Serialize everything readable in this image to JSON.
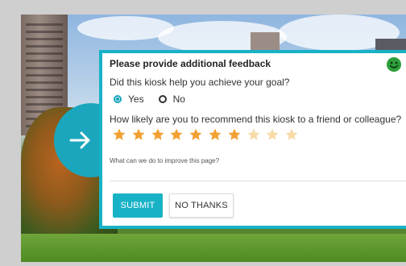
{
  "feedback": {
    "title": "Please provide additional feedback",
    "question_goal": "Did this kiosk help you achieve your goal?",
    "options": [
      {
        "label": "Yes",
        "selected": true
      },
      {
        "label": "No",
        "selected": false
      }
    ],
    "question_recommend": "How likely are you to recommend this kiosk to a friend or colleague?",
    "rating": {
      "value": 7,
      "max": 10
    },
    "improve_placeholder": "What can we do to improve this page?",
    "submit_label": "SUBMIT",
    "no_thanks_label": "NO THANKS"
  },
  "colors": {
    "accent": "#18b2c6",
    "star_filled": "#f2a033",
    "star_empty": "#f7dca8",
    "smiley": "#2e9f3a"
  },
  "icons": {
    "next": "right-arrow-icon",
    "mood": "smiley-face-icon",
    "rating": "star-icon"
  }
}
